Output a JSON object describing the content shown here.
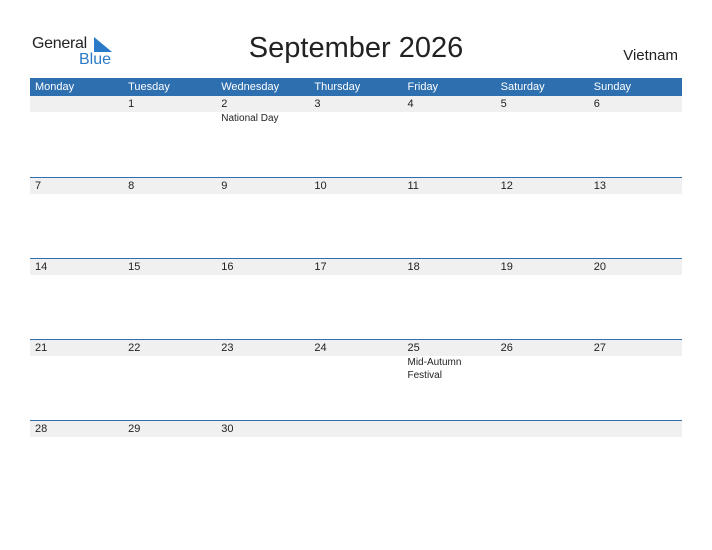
{
  "logo": {
    "word1": "General",
    "word2": "Blue",
    "icon": "blue-triangle-icon"
  },
  "title": "September 2026",
  "country": "Vietnam",
  "colors": {
    "header_bg": "#2e6fb0",
    "row_band": "#f0f0f0",
    "brand_blue": "#2a7ac8"
  },
  "weekdays": [
    "Monday",
    "Tuesday",
    "Wednesday",
    "Thursday",
    "Friday",
    "Saturday",
    "Sunday"
  ],
  "weeks": [
    [
      {
        "day": ""
      },
      {
        "day": "1"
      },
      {
        "day": "2",
        "holiday": "National Day"
      },
      {
        "day": "3"
      },
      {
        "day": "4"
      },
      {
        "day": "5"
      },
      {
        "day": "6"
      }
    ],
    [
      {
        "day": "7"
      },
      {
        "day": "8"
      },
      {
        "day": "9"
      },
      {
        "day": "10"
      },
      {
        "day": "11"
      },
      {
        "day": "12"
      },
      {
        "day": "13"
      }
    ],
    [
      {
        "day": "14"
      },
      {
        "day": "15"
      },
      {
        "day": "16"
      },
      {
        "day": "17"
      },
      {
        "day": "18"
      },
      {
        "day": "19"
      },
      {
        "day": "20"
      }
    ],
    [
      {
        "day": "21"
      },
      {
        "day": "22"
      },
      {
        "day": "23"
      },
      {
        "day": "24"
      },
      {
        "day": "25",
        "holiday": "Mid-Autumn Festival"
      },
      {
        "day": "26"
      },
      {
        "day": "27"
      }
    ],
    [
      {
        "day": "28"
      },
      {
        "day": "29"
      },
      {
        "day": "30"
      },
      {
        "day": ""
      },
      {
        "day": ""
      },
      {
        "day": ""
      },
      {
        "day": ""
      }
    ]
  ]
}
